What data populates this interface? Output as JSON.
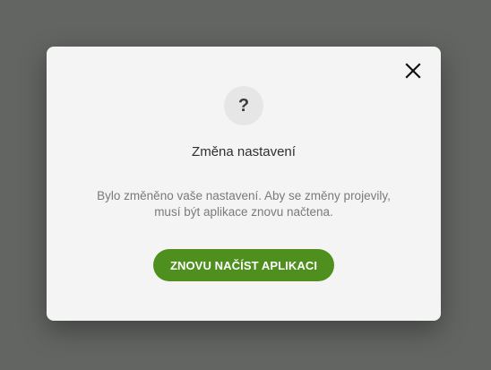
{
  "dialog": {
    "close_icon": "close-icon",
    "question_icon": "question-mark-icon",
    "question_glyph": "?",
    "title": "Změna nastavení",
    "message_line1": "Bylo změněno vaše nastavení. Aby se změny projevily,",
    "message_line2": "musí být aplikace znovu načtena.",
    "reload_button_label": "ZNOVU NAČÍST APLIKACI"
  },
  "colors": {
    "backdrop": "#636563",
    "dialog_background": "#f4f4f4",
    "primary_button": "#4e8f1e",
    "icon_circle": "#e6e6e6"
  }
}
